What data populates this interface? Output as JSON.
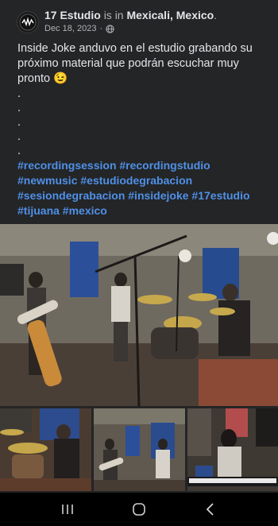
{
  "post": {
    "page_name": "17 Estudio",
    "is_in": "is in",
    "location": "Mexicali, Mexico",
    "period": ".",
    "date": "Dec 18, 2023",
    "separator": "·",
    "privacy_icon": "globe-icon",
    "avatar_icon": "logo-avatar",
    "text_line": "Inside Joke anduvo en el estudio grabando su próximo material que podrán escuchar muy pronto",
    "emoji": "😉",
    "dots": [
      ".",
      ".",
      ".",
      ".",
      "."
    ],
    "hashtags": "#recordingsession #recordingstudio #newmusic #estudiodegrabacion #sesiondegrabacion #insidejoke #17estudio #tijuana #mexico"
  },
  "photos": {
    "main_alt": "band recording in studio",
    "thumb_a_alt": "drummer close-up",
    "thumb_b_alt": "band wide shot",
    "thumb_c_alt": "keyboard player"
  },
  "navbar": {
    "recents_icon": "recents-icon",
    "home_icon": "home-icon",
    "back_icon": "back-icon"
  },
  "colors": {
    "card_bg": "#242526",
    "hashtag": "#4f90e8",
    "muted": "#b0b3b8"
  }
}
